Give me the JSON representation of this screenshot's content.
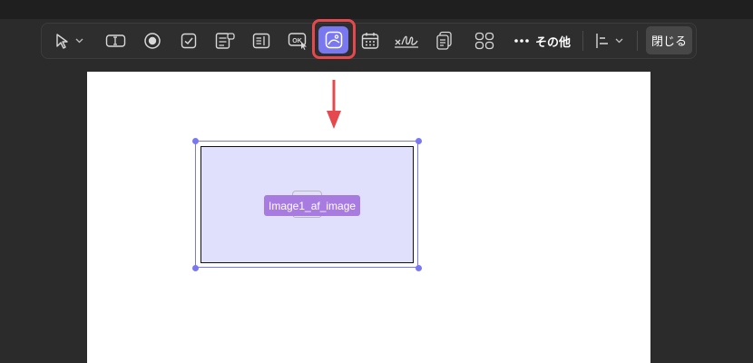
{
  "toolbar": {
    "tools": [
      {
        "name": "select-tool",
        "icon": "pointer-icon",
        "has_dropdown": true
      },
      {
        "name": "text-field-tool",
        "icon": "text-field-icon"
      },
      {
        "name": "radio-button-tool",
        "icon": "radio-button-icon"
      },
      {
        "name": "checkbox-tool",
        "icon": "checkbox-icon"
      },
      {
        "name": "combo-box-tool",
        "icon": "combo-box-icon"
      },
      {
        "name": "list-box-tool",
        "icon": "list-box-icon"
      },
      {
        "name": "ok-button-tool",
        "icon": "button-field-icon",
        "glyph": "OK"
      },
      {
        "name": "image-field-tool",
        "icon": "image-field-icon",
        "selected": true
      },
      {
        "name": "date-field-tool",
        "icon": "calendar-icon"
      },
      {
        "name": "signature-tool",
        "icon": "signature-icon"
      },
      {
        "name": "document-tool",
        "icon": "document-stack-icon"
      },
      {
        "name": "grid-tool",
        "icon": "grid-icon"
      }
    ],
    "more_label": "その他",
    "align_tool": {
      "icon": "align-left-icon",
      "has_dropdown": true
    },
    "close_label": "閉じる"
  },
  "canvas": {
    "image_field": {
      "label": "Image1_af_image"
    }
  },
  "colors": {
    "accent": "#7a78f0",
    "highlight": "#e5484d",
    "field_fill": "#e0e0fc",
    "field_label_bg": "#a77be0"
  }
}
